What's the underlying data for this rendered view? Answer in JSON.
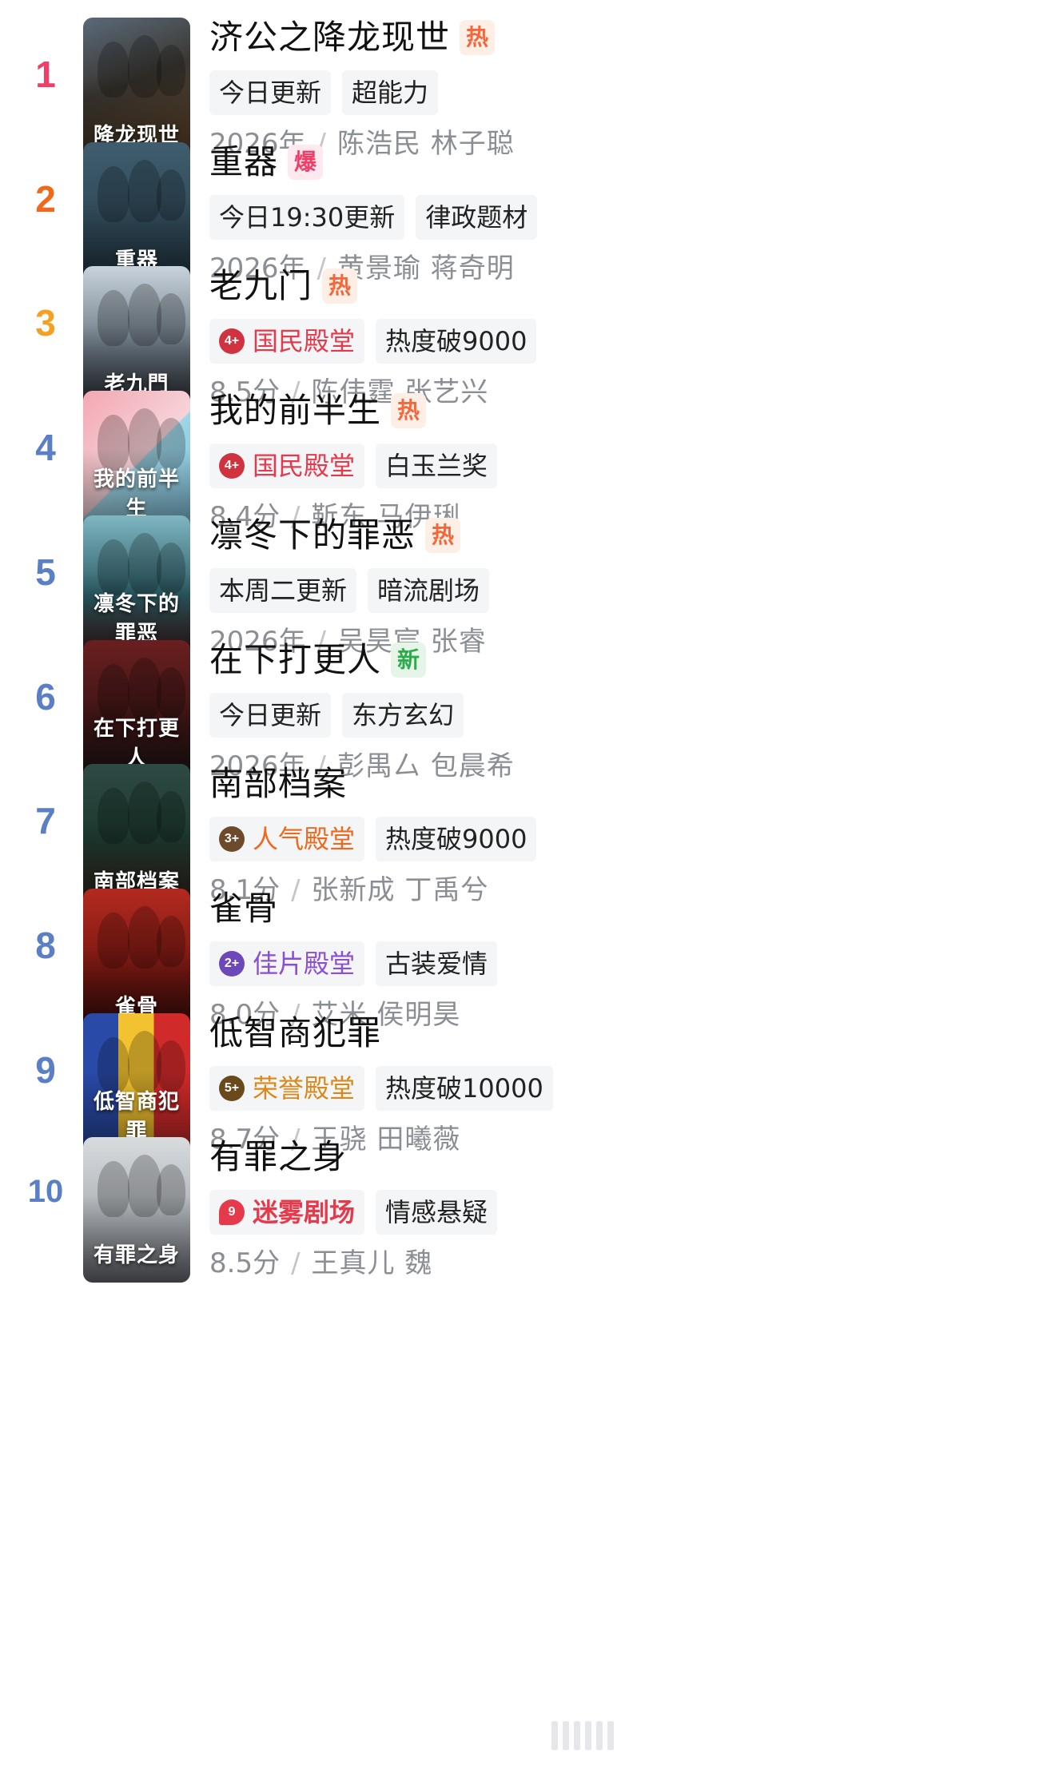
{
  "items": [
    {
      "rank": "1",
      "rank_color": "#ef3e68",
      "title": "济公之降龙现世",
      "badge": "热",
      "badge_type": "hot",
      "tags": [
        {
          "text": "今日更新"
        },
        {
          "text": "超能力"
        }
      ],
      "meta_left": "2026年",
      "cast": "陈浩民 林子聪",
      "poster": {
        "bg": "linear-gradient(160deg,#5a6a7a 0%,#3a3630 45%,#6b4a2a 100%)",
        "text": "降龙现世"
      }
    },
    {
      "rank": "2",
      "rank_color": "#f0681b",
      "title": "重器",
      "badge": "爆",
      "badge_type": "boom",
      "tags": [
        {
          "text": "今日19:30更新"
        },
        {
          "text": "律政题材"
        }
      ],
      "meta_left": "2026年",
      "cast": "黄景瑜 蒋奇明",
      "poster": {
        "bg": "linear-gradient(180deg,#3f5d6e 0%,#243a47 100%)",
        "text": "重器"
      }
    },
    {
      "rank": "3",
      "rank_color": "#f5a023",
      "title": "老九门",
      "badge": "热",
      "badge_type": "hot",
      "tags": [
        {
          "text": "国民殿堂",
          "hall": "hall-red",
          "medal": "4+"
        },
        {
          "text": "热度破9000"
        }
      ],
      "meta_left": "8.5分",
      "cast": "陈伟霆 张艺兴",
      "poster": {
        "bg": "linear-gradient(180deg,#c8d3dc 0%,#6d7a86 55%,#2e3338 100%)",
        "text": "老九門"
      }
    },
    {
      "rank": "4",
      "rank_color": "#5b7fc4",
      "title": "我的前半生",
      "badge": "热",
      "badge_type": "hot",
      "tags": [
        {
          "text": "国民殿堂",
          "hall": "hall-red",
          "medal": "4+"
        },
        {
          "text": "白玉兰奖"
        }
      ],
      "meta_left": "8.4分",
      "cast": "靳东 马伊琍",
      "poster": {
        "bg": "linear-gradient(135deg,#f3a7b2 0%,#f6d3d8 50%,#9ed4e6 51%,#7fc3dc 100%)",
        "text": "我的前半生"
      }
    },
    {
      "rank": "5",
      "rank_color": "#5b7fc4",
      "title": "凛冬下的罪恶",
      "badge": "热",
      "badge_type": "hot",
      "tags": [
        {
          "text": "本周二更新"
        },
        {
          "text": "暗流剧场"
        }
      ],
      "meta_left": "2026年",
      "cast": "吴昊宸 张睿",
      "poster": {
        "bg": "linear-gradient(180deg,#7fb6c2 0%,#2c5d66 55%,#4a1e1e 100%)",
        "text": "凛冬下的罪恶"
      }
    },
    {
      "rank": "6",
      "rank_color": "#5b7fc4",
      "title": "在下打更人",
      "badge": "新",
      "badge_type": "new",
      "tags": [
        {
          "text": "今日更新"
        },
        {
          "text": "东方玄幻"
        }
      ],
      "meta_left": "2026年",
      "cast": "彭禺厶 包晨希",
      "poster": {
        "bg": "linear-gradient(180deg,#6a1f1f 0%,#3a1414 60%,#1e1a18 100%)",
        "text": "在下打更人"
      }
    },
    {
      "rank": "7",
      "rank_color": "#5b7fc4",
      "title": "南部档案",
      "badge": "",
      "badge_type": "",
      "tags": [
        {
          "text": "人气殿堂",
          "hall": "hall-orange",
          "medal": "3+"
        },
        {
          "text": "热度破9000"
        }
      ],
      "meta_left": "8.1分",
      "cast": "张新成 丁禹兮",
      "poster": {
        "bg": "linear-gradient(180deg,#2e4a44 0%,#1d3a30 50%,#3a2a1e 100%)",
        "text": "南部档案"
      }
    },
    {
      "rank": "8",
      "rank_color": "#5b7fc4",
      "title": "雀骨",
      "badge": "",
      "badge_type": "",
      "tags": [
        {
          "text": "佳片殿堂",
          "hall": "hall-purple",
          "medal": "2+"
        },
        {
          "text": "古装爱情"
        }
      ],
      "meta_left": "8.0分",
      "cast": "艾米 侯明昊",
      "poster": {
        "bg": "linear-gradient(180deg,#b32a1f 0%,#7a1812 55%,#3a0c0a 100%)",
        "text": "雀骨"
      }
    },
    {
      "rank": "9",
      "rank_color": "#5b7fc4",
      "title": "低智商犯罪",
      "badge": "",
      "badge_type": "",
      "tags": [
        {
          "text": "荣誉殿堂",
          "hall": "hall-gold",
          "medal": "5+"
        },
        {
          "text": "热度破10000"
        }
      ],
      "meta_left": "8.7分",
      "cast": "王骁 田曦薇",
      "poster": {
        "bg": "linear-gradient(90deg,#2a4aa8 0%,#2a4aa8 33%,#f2c230 33%,#f2c230 66%,#d02a2a 66%,#d02a2a 100%)",
        "text": "低智商犯罪"
      }
    },
    {
      "rank": "10",
      "rank_color": "#5b7fc4",
      "title": "有罪之身",
      "badge": "",
      "badge_type": "",
      "tags": [
        {
          "text": "迷雾剧场",
          "hall": "migu",
          "medal": "9"
        },
        {
          "text": "情感悬疑"
        }
      ],
      "meta_left": "8.5分",
      "cast": "王真儿 魏",
      "poster": {
        "bg": "linear-gradient(180deg,#d9dcdf 0%,#a9adb2 60%,#7c8086 100%)",
        "text": "有罪之身"
      }
    }
  ],
  "separator": "/"
}
